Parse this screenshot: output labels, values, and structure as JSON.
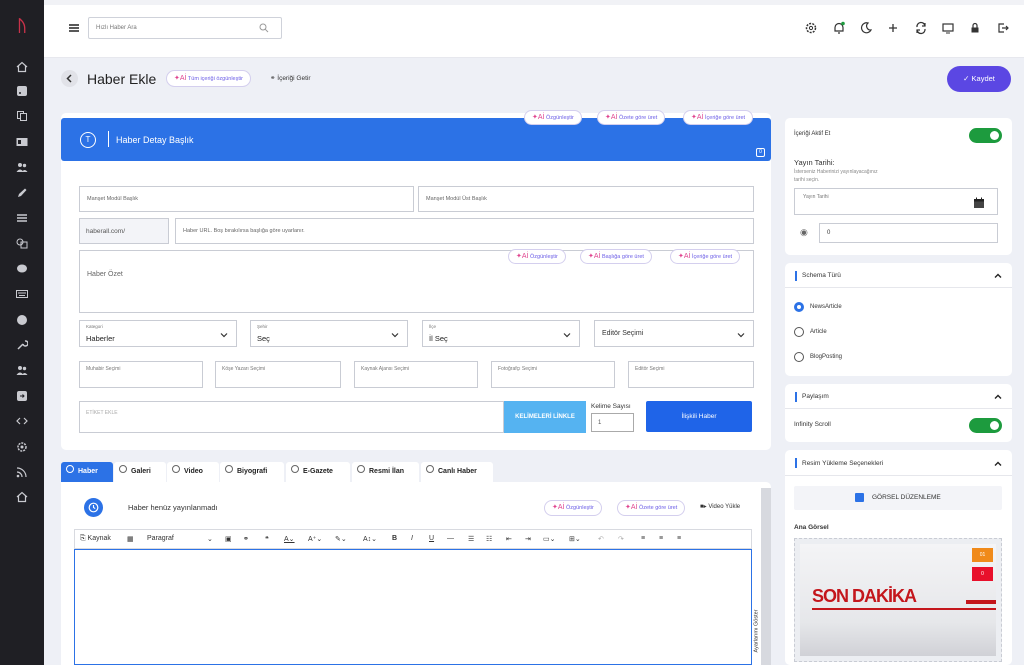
{
  "topbar": {
    "search_placeholder": "Hızlı Haber Ara"
  },
  "page": {
    "title": "Haber Ekle",
    "ai_all_label": "Tüm içeriği özgünleştir",
    "fetch_label": "İçeriği Getir",
    "save_label": "Kaydet"
  },
  "ai_prefix": "✦Aİ",
  "title_section": {
    "ai_buttons": [
      "Özgünleştir",
      "Özete göre üret",
      "İçeriğe göre üret"
    ],
    "header_label": "Haber Detay Başlık",
    "manset_title_ph": "Manşet Modül Başlık",
    "manset_sub_ph": "Manşet Modül Üst Başlık",
    "url_prefix": "haberall.com/",
    "url_ph": "Haber URL. Boş bırakılırsa başlığa göre uyarlanır.",
    "summary_ph": "Haber Özet",
    "summary_ai_buttons": [
      "Özgünleştir",
      "Başlığa göre üret",
      "İçeriğe göre üret"
    ],
    "selects": [
      {
        "label": "Kategori",
        "value": "Haberler"
      },
      {
        "label": "Şehir",
        "value": "Seç"
      },
      {
        "label": "İlçe",
        "value": "İl Seç"
      },
      {
        "label": "",
        "value": "Editör Seçimi"
      }
    ],
    "pickers": [
      "Muhabir Seçimi",
      "Köşe Yazarı Seçimi",
      "Kaynak Ajansı Seçimi",
      "Fotoğrafçı Seçimi",
      "Editör Seçimi"
    ],
    "tag_ph": "ETİKET EKLE",
    "keyword_btn": "KELİMELERİ LİNKLE",
    "word_count_label": "Kelime Sayısı",
    "word_count": "1",
    "related_btn": "İlişkili Haber"
  },
  "tabs": [
    "Haber",
    "Galeri",
    "Video",
    "Biyografi",
    "E-Gazete",
    "Resmi İlan",
    "Canlı Haber"
  ],
  "content": {
    "status": "Haber henüz yayınlanmadı",
    "ai_buttons": [
      "Özgünleştir",
      "Özete göre üret"
    ],
    "video_label": "Video Yükle",
    "toolbar": {
      "source": "Kaynak",
      "paragraph": "Paragraf"
    },
    "side_label": "Ayarlarımı Göster"
  },
  "right": {
    "active_label": "İçeriği Aktif Et",
    "publish_title": "Yayın Tarihi:",
    "publish_help1": "İsterseniz Haberinizi yayınlayacağınız",
    "publish_help2": "tarihi seçin.",
    "publish_ph": "Yayın Tarihi",
    "view_count": "0",
    "schema_title": "Schema Türü",
    "schema_options": [
      "NewsArticle",
      "Article",
      "BlogPosting"
    ],
    "share_title": "Paylaşım",
    "infinity_label": "Infinity Scroll",
    "image_title": "Resim Yükleme Seçenekleri",
    "edit_btn": "GÖRSEL DÜZENLEME",
    "main_image_label": "Ana Görsel",
    "img_btn1": "01",
    "img_btn2": "0",
    "image_text1": "SON",
    "image_text2": "DAKİKA"
  },
  "colors": {
    "primary": "#2c72e6",
    "save": "#5b47e3",
    "toggle": "#1d9b3e",
    "ai": "#e0458f"
  }
}
